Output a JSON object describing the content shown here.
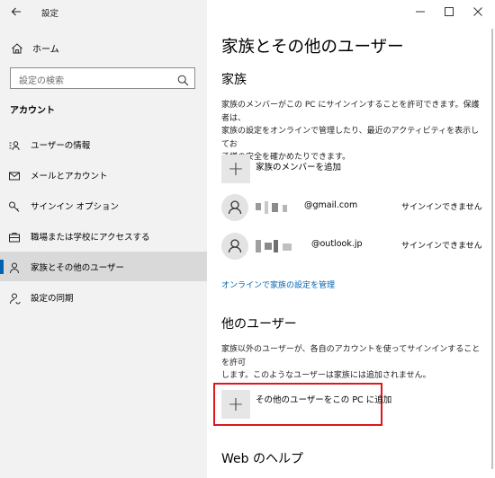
{
  "window": {
    "app_title": "設定",
    "controls": [
      "—",
      "☐",
      "✕"
    ]
  },
  "sidebar": {
    "home_label": "ホーム",
    "search": {
      "placeholder": "設定の検索"
    },
    "section_header": "アカウント",
    "items": [
      {
        "label": "ユーザーの情報",
        "icon": "user-info-icon"
      },
      {
        "label": "メールとアカウント",
        "icon": "mail-icon"
      },
      {
        "label": "サインイン オプション",
        "icon": "key-icon"
      },
      {
        "label": "職場または学校にアクセスする",
        "icon": "briefcase-icon"
      },
      {
        "label": "家族とその他のユーザー",
        "icon": "family-icon",
        "selected": true
      },
      {
        "label": "設定の同期",
        "icon": "sync-icon"
      }
    ]
  },
  "main": {
    "title": "家族とその他のユーザー",
    "family": {
      "heading": "家族",
      "description_lines": [
        "家族のメンバーがこの PC にサインインすることを許可できます。保護者は、",
        "家族の設定をオンラインで管理したり、最近のアクティビティを表示してお",
        "子様の安全を確かめたりできます。"
      ],
      "add_label": "家族のメンバーを追加",
      "members": [
        {
          "email_suffix": "@gmail.com",
          "status": "サインインできません"
        },
        {
          "email_suffix": "@outlook.jp",
          "status": "サインインできません"
        }
      ],
      "manage_link": "オンラインで家族の設定を管理"
    },
    "other_users": {
      "heading": "他のユーザー",
      "description_lines": [
        "家族以外のユーザーが、各自のアカウントを使ってサインインすることを許可",
        "します。このようなユーザーは家族には追加されません。"
      ],
      "add_label": "その他のユーザーをこの PC に追加"
    },
    "help_heading": "Web のヘルプ"
  },
  "colors": {
    "accent": "#0063b1",
    "highlight_box": "#e0161b",
    "sidebar_bg": "#f2f2f2"
  }
}
